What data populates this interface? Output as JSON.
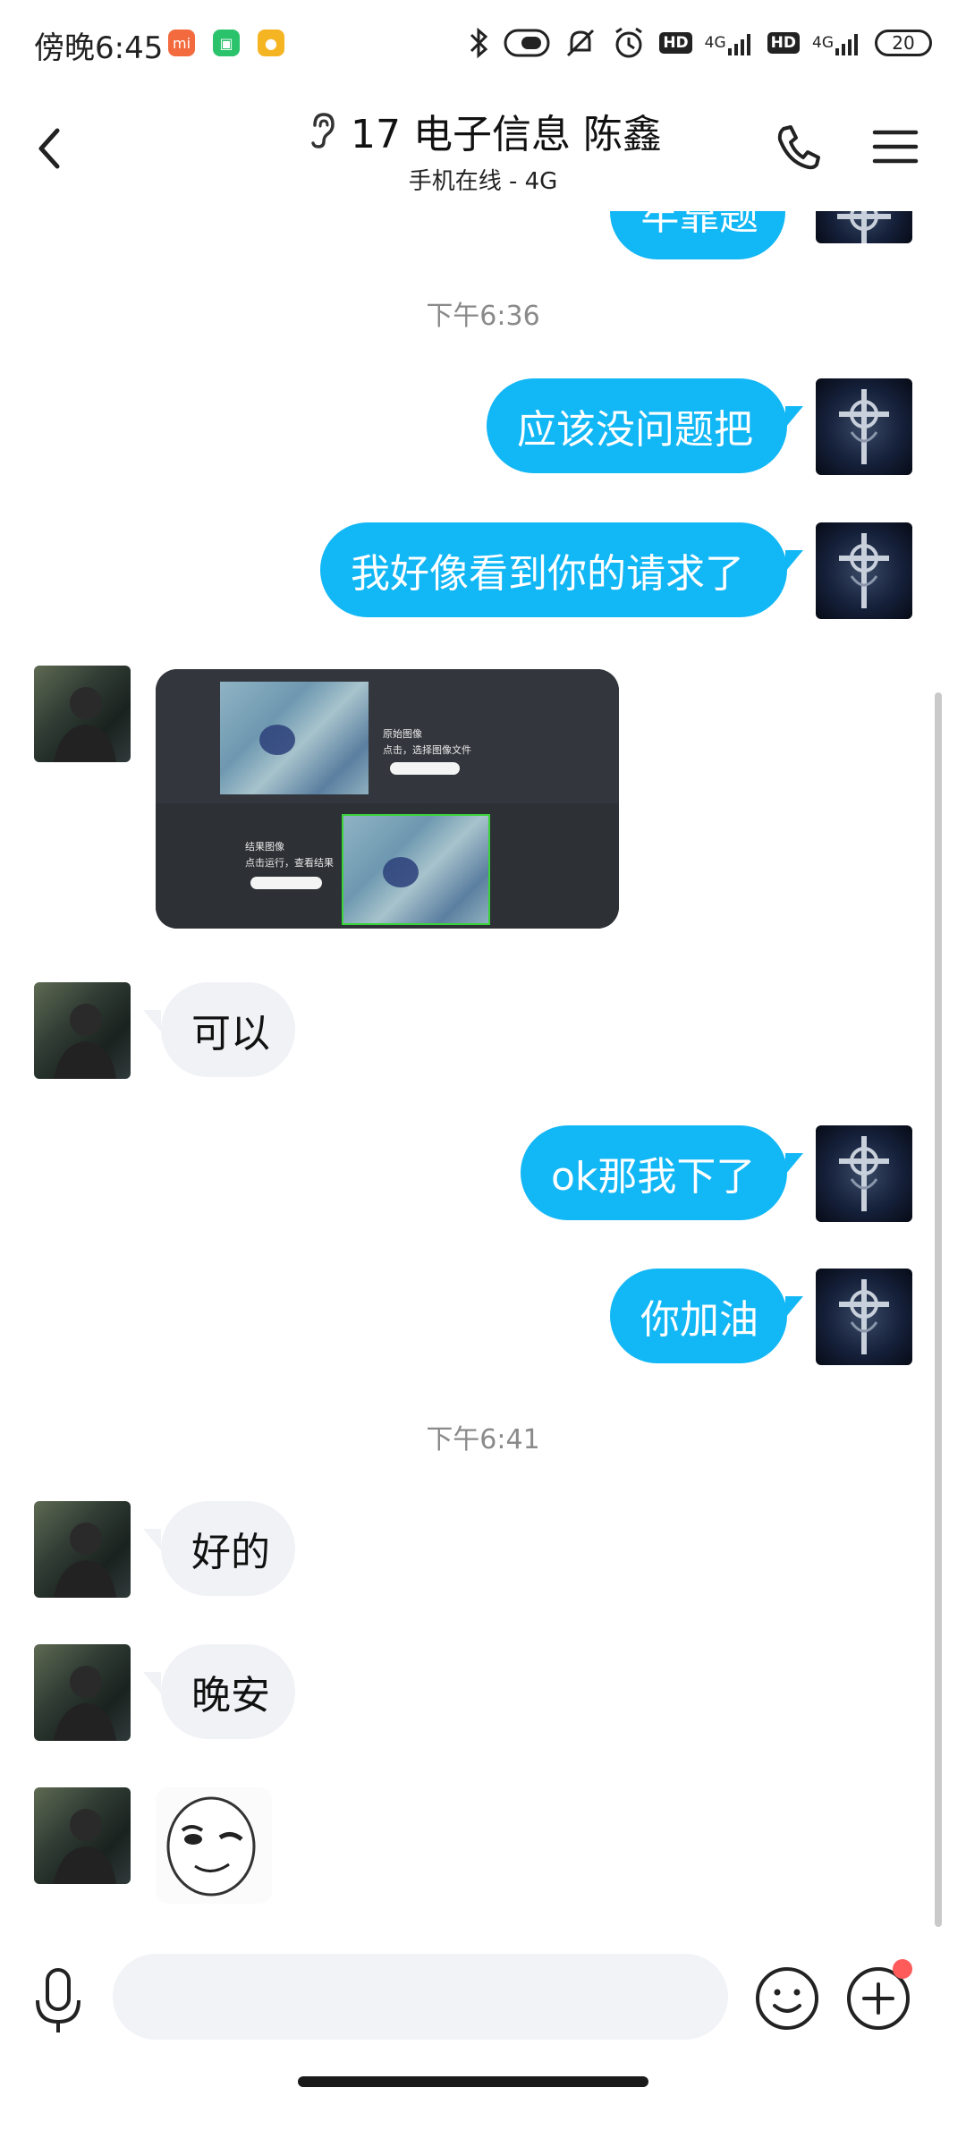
{
  "status_bar": {
    "time": "傍晚6:45",
    "network_1": "4G",
    "network_2": "4G",
    "hd": "HD",
    "battery": "20"
  },
  "header": {
    "title": "17 电子信息 陈鑫",
    "subtitle": "手机在线 - 4G"
  },
  "messages": {
    "partial_text": "牢靠题",
    "ts1": "下午6:36",
    "m1": "应该没问题把",
    "m2": "我好像看到你的请求了",
    "image": {
      "label_original": "原始图像",
      "hint_original": "点击，选择图像文件",
      "label_result": "结果图像",
      "hint_result": "点击运行，查看结果"
    },
    "m3": "可以",
    "m4": "ok那我下了",
    "m5": "你加油",
    "ts2": "下午6:41",
    "m6": "好的",
    "m7": "晚安"
  },
  "colors": {
    "accent": "#12b7f5",
    "incoming_bubble": "#f1f2f6",
    "badge": "#ff5b5b"
  },
  "input": {
    "placeholder": ""
  }
}
